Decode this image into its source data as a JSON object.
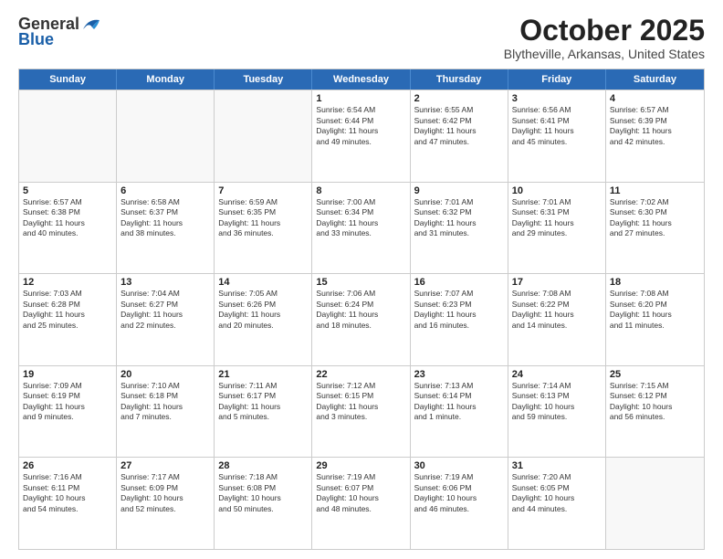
{
  "header": {
    "logo": {
      "general": "General",
      "blue": "Blue"
    },
    "title": "October 2025",
    "subtitle": "Blytheville, Arkansas, United States"
  },
  "days_of_week": [
    "Sunday",
    "Monday",
    "Tuesday",
    "Wednesday",
    "Thursday",
    "Friday",
    "Saturday"
  ],
  "weeks": [
    [
      {
        "day": "",
        "info": ""
      },
      {
        "day": "",
        "info": ""
      },
      {
        "day": "",
        "info": ""
      },
      {
        "day": "1",
        "info": "Sunrise: 6:54 AM\nSunset: 6:44 PM\nDaylight: 11 hours\nand 49 minutes."
      },
      {
        "day": "2",
        "info": "Sunrise: 6:55 AM\nSunset: 6:42 PM\nDaylight: 11 hours\nand 47 minutes."
      },
      {
        "day": "3",
        "info": "Sunrise: 6:56 AM\nSunset: 6:41 PM\nDaylight: 11 hours\nand 45 minutes."
      },
      {
        "day": "4",
        "info": "Sunrise: 6:57 AM\nSunset: 6:39 PM\nDaylight: 11 hours\nand 42 minutes."
      }
    ],
    [
      {
        "day": "5",
        "info": "Sunrise: 6:57 AM\nSunset: 6:38 PM\nDaylight: 11 hours\nand 40 minutes."
      },
      {
        "day": "6",
        "info": "Sunrise: 6:58 AM\nSunset: 6:37 PM\nDaylight: 11 hours\nand 38 minutes."
      },
      {
        "day": "7",
        "info": "Sunrise: 6:59 AM\nSunset: 6:35 PM\nDaylight: 11 hours\nand 36 minutes."
      },
      {
        "day": "8",
        "info": "Sunrise: 7:00 AM\nSunset: 6:34 PM\nDaylight: 11 hours\nand 33 minutes."
      },
      {
        "day": "9",
        "info": "Sunrise: 7:01 AM\nSunset: 6:32 PM\nDaylight: 11 hours\nand 31 minutes."
      },
      {
        "day": "10",
        "info": "Sunrise: 7:01 AM\nSunset: 6:31 PM\nDaylight: 11 hours\nand 29 minutes."
      },
      {
        "day": "11",
        "info": "Sunrise: 7:02 AM\nSunset: 6:30 PM\nDaylight: 11 hours\nand 27 minutes."
      }
    ],
    [
      {
        "day": "12",
        "info": "Sunrise: 7:03 AM\nSunset: 6:28 PM\nDaylight: 11 hours\nand 25 minutes."
      },
      {
        "day": "13",
        "info": "Sunrise: 7:04 AM\nSunset: 6:27 PM\nDaylight: 11 hours\nand 22 minutes."
      },
      {
        "day": "14",
        "info": "Sunrise: 7:05 AM\nSunset: 6:26 PM\nDaylight: 11 hours\nand 20 minutes."
      },
      {
        "day": "15",
        "info": "Sunrise: 7:06 AM\nSunset: 6:24 PM\nDaylight: 11 hours\nand 18 minutes."
      },
      {
        "day": "16",
        "info": "Sunrise: 7:07 AM\nSunset: 6:23 PM\nDaylight: 11 hours\nand 16 minutes."
      },
      {
        "day": "17",
        "info": "Sunrise: 7:08 AM\nSunset: 6:22 PM\nDaylight: 11 hours\nand 14 minutes."
      },
      {
        "day": "18",
        "info": "Sunrise: 7:08 AM\nSunset: 6:20 PM\nDaylight: 11 hours\nand 11 minutes."
      }
    ],
    [
      {
        "day": "19",
        "info": "Sunrise: 7:09 AM\nSunset: 6:19 PM\nDaylight: 11 hours\nand 9 minutes."
      },
      {
        "day": "20",
        "info": "Sunrise: 7:10 AM\nSunset: 6:18 PM\nDaylight: 11 hours\nand 7 minutes."
      },
      {
        "day": "21",
        "info": "Sunrise: 7:11 AM\nSunset: 6:17 PM\nDaylight: 11 hours\nand 5 minutes."
      },
      {
        "day": "22",
        "info": "Sunrise: 7:12 AM\nSunset: 6:15 PM\nDaylight: 11 hours\nand 3 minutes."
      },
      {
        "day": "23",
        "info": "Sunrise: 7:13 AM\nSunset: 6:14 PM\nDaylight: 11 hours\nand 1 minute."
      },
      {
        "day": "24",
        "info": "Sunrise: 7:14 AM\nSunset: 6:13 PM\nDaylight: 10 hours\nand 59 minutes."
      },
      {
        "day": "25",
        "info": "Sunrise: 7:15 AM\nSunset: 6:12 PM\nDaylight: 10 hours\nand 56 minutes."
      }
    ],
    [
      {
        "day": "26",
        "info": "Sunrise: 7:16 AM\nSunset: 6:11 PM\nDaylight: 10 hours\nand 54 minutes."
      },
      {
        "day": "27",
        "info": "Sunrise: 7:17 AM\nSunset: 6:09 PM\nDaylight: 10 hours\nand 52 minutes."
      },
      {
        "day": "28",
        "info": "Sunrise: 7:18 AM\nSunset: 6:08 PM\nDaylight: 10 hours\nand 50 minutes."
      },
      {
        "day": "29",
        "info": "Sunrise: 7:19 AM\nSunset: 6:07 PM\nDaylight: 10 hours\nand 48 minutes."
      },
      {
        "day": "30",
        "info": "Sunrise: 7:19 AM\nSunset: 6:06 PM\nDaylight: 10 hours\nand 46 minutes."
      },
      {
        "day": "31",
        "info": "Sunrise: 7:20 AM\nSunset: 6:05 PM\nDaylight: 10 hours\nand 44 minutes."
      },
      {
        "day": "",
        "info": ""
      }
    ]
  ]
}
